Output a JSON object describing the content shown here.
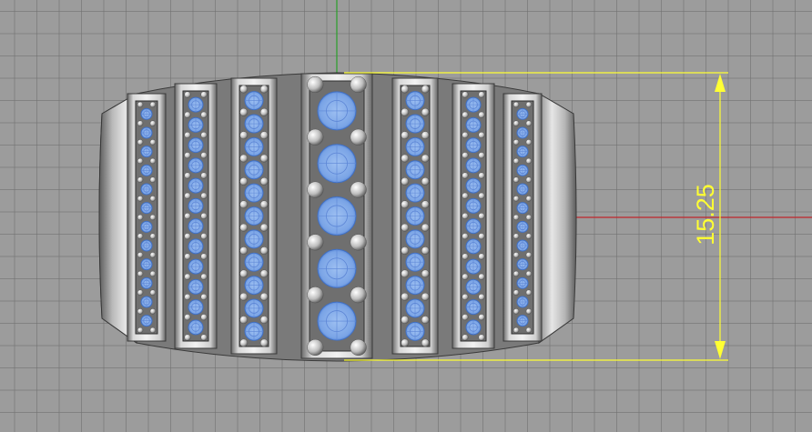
{
  "viewport": {
    "axis_colors": {
      "x": "#c0262b",
      "y": "#2aa02a"
    },
    "model_colors": {
      "metal_light": "#e2e2e2",
      "metal_dark": "#595959",
      "stone": "#7ea7e6",
      "stone_edge": "#3f6fc4",
      "prong": "#d9d9d9"
    }
  },
  "dimension": {
    "value": "15.25",
    "color": "#ffff33"
  }
}
